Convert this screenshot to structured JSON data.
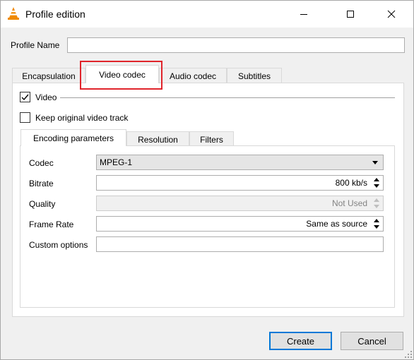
{
  "window": {
    "title": "Profile edition"
  },
  "profile": {
    "name_label": "Profile Name",
    "name_value": ""
  },
  "tabs": [
    {
      "label": "Encapsulation"
    },
    {
      "label": "Video codec"
    },
    {
      "label": "Audio codec"
    },
    {
      "label": "Subtitles"
    }
  ],
  "video": {
    "video_label": "Video",
    "video_checked": true,
    "keep_label": "Keep original video track",
    "keep_checked": false
  },
  "subtabs": [
    {
      "label": "Encoding parameters"
    },
    {
      "label": "Resolution"
    },
    {
      "label": "Filters"
    }
  ],
  "encoding": {
    "codec_label": "Codec",
    "codec_value": "MPEG-1",
    "bitrate_label": "Bitrate",
    "bitrate_value": "800 kb/s",
    "quality_label": "Quality",
    "quality_value": "Not Used",
    "framerate_label": "Frame Rate",
    "framerate_value": "Same as source",
    "custom_label": "Custom options",
    "custom_value": ""
  },
  "buttons": {
    "create": "Create",
    "cancel": "Cancel"
  },
  "colors": {
    "highlight": "#e0242b",
    "accent": "#0078d7"
  }
}
